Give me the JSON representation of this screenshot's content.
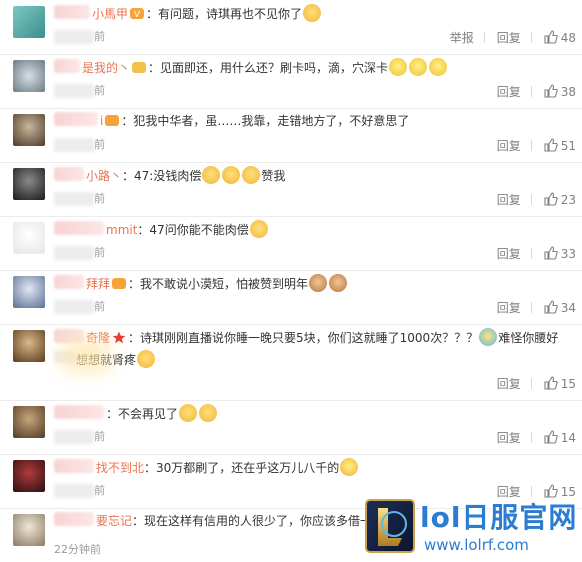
{
  "colors": {
    "username": "#eb7350",
    "text": "#333333",
    "meta": "#999999",
    "action": "#808080",
    "watermark": "#2b7cd3"
  },
  "comments": [
    {
      "username_visible": "小馬甲",
      "has_badge": true,
      "text": "：有问题，诗琪再也不见你了",
      "emojis_after": 1,
      "time_tail": "前",
      "show_report": true,
      "report_label": "举报",
      "reply_label": "回复",
      "likes": "48"
    },
    {
      "username_visible": "是我的丶",
      "has_badge": true,
      "text": "：见面即还，用什么还？刷卡吗，滴，穴深卡",
      "emojis_after": 3,
      "time_tail": "前",
      "show_report": false,
      "report_label": "",
      "reply_label": "回复",
      "likes": "38"
    },
    {
      "username_visible": "i",
      "has_badge": true,
      "text": "：犯我中华者，虽……我靠，走错地方了，不好意思了",
      "emojis_after": 0,
      "time_tail": "前",
      "show_report": false,
      "report_label": "",
      "reply_label": "回复",
      "likes": "51"
    },
    {
      "username_visible": "小路丶",
      "has_badge": false,
      "text": "：47:没钱肉偿",
      "emojis_after": 3,
      "text_after": "赞我",
      "time_tail": "前",
      "show_report": false,
      "report_label": "",
      "reply_label": "回复",
      "likes": "23"
    },
    {
      "username_visible": "mmit",
      "has_badge": false,
      "text": "：47问你能不能肉偿",
      "emojis_after": 1,
      "time_tail": "前",
      "show_report": false,
      "report_label": "",
      "reply_label": "回复",
      "likes": "33"
    },
    {
      "username_visible": "拜拜",
      "has_badge": true,
      "text": "：我不敢说小漠短，怕被赞到明年",
      "emojis_after": 2,
      "time_tail": "前",
      "show_report": false,
      "report_label": "",
      "reply_label": "回复",
      "likes": "34"
    },
    {
      "username_visible": "奇隆",
      "has_badge": true,
      "text": "：诗琪刚刚直播说你睡一晚只要5块，你们这就睡了1000次？？？",
      "emojis_after": 1,
      "text_after": "难怪你腰好",
      "line2_text": "想想就肾疼",
      "time_tail": "",
      "show_report": false,
      "report_label": "",
      "reply_label": "回复",
      "likes": "15"
    },
    {
      "username_visible": "",
      "has_badge": false,
      "text": "：不会再见了",
      "emojis_after": 2,
      "time_tail": "前",
      "show_report": false,
      "report_label": "",
      "reply_label": "回复",
      "likes": "14"
    },
    {
      "username_visible": "找不到北",
      "has_badge": false,
      "text": "：30万都刷了，还在乎这万儿八千的",
      "emojis_after": 1,
      "time_tail": "前",
      "show_report": false,
      "report_label": "",
      "reply_label": "回复",
      "likes": "15"
    },
    {
      "username_visible": "要忘记",
      "has_badge": false,
      "text": "：现在这样有信用的人很少了，你应该多借一",
      "emojis_after": 0,
      "time_tail": "",
      "show_report": false,
      "report_label": "",
      "reply_label": "",
      "likes": ""
    }
  ],
  "last_time": "22分钟前",
  "watermark": {
    "title": "lol日服官网",
    "url": "www.lolrf.com"
  }
}
